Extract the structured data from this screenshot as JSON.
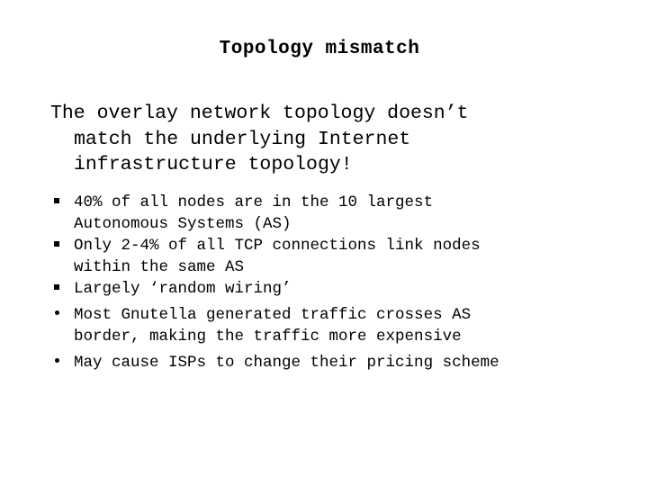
{
  "slide": {
    "title": "Topology mismatch",
    "intro_lines": [
      "The overlay network topology doesn’t",
      "match the underlying Internet",
      "infrastructure topology!"
    ],
    "bullets": [
      {
        "marker": "square-bullet",
        "lines": [
          "40% of all nodes are in the 10 largest",
          "Autonomous Systems (AS)"
        ]
      },
      {
        "marker": "square-bullet",
        "lines": [
          "Only 2-4% of all TCP connections link nodes",
          "within the same AS"
        ]
      },
      {
        "marker": "square-bullet",
        "lines": [
          "Largely ‘random wiring’"
        ]
      },
      {
        "marker": "round-bullet",
        "lines": [
          "Most Gnutella generated traffic crosses AS",
          "border, making the traffic more expensive"
        ]
      },
      {
        "marker": "round-bullet",
        "lines": [
          "May cause ISPs to change their pricing scheme"
        ]
      }
    ]
  }
}
